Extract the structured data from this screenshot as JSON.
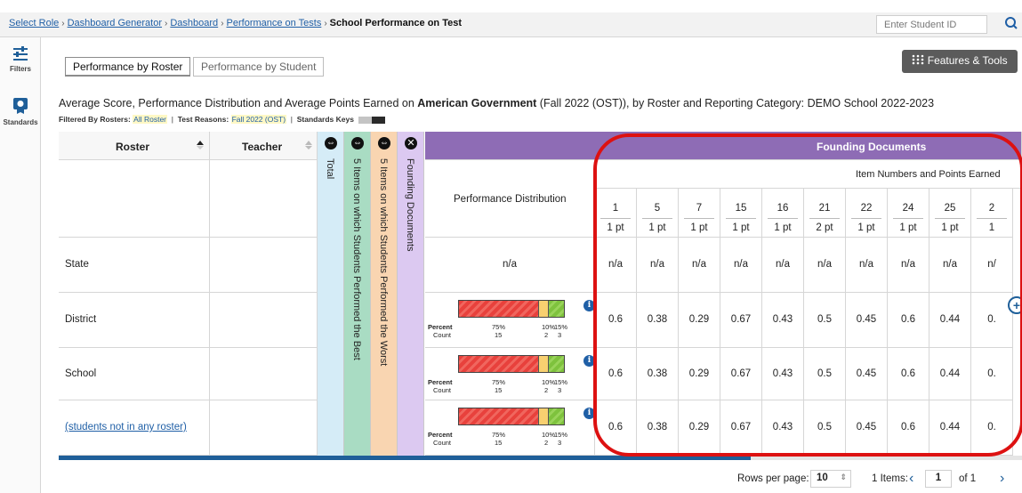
{
  "breadcrumb": {
    "items": [
      "Select Role",
      "Dashboard Generator",
      "Dashboard",
      "Performance on Tests"
    ],
    "current": "School Performance on Test",
    "separator": "›"
  },
  "search": {
    "placeholder": "Enter Student ID"
  },
  "rail": {
    "filters_label": "Filters",
    "standards_label": "Standards"
  },
  "tabs": {
    "by_roster": "Performance by Roster",
    "by_student": "Performance by Student"
  },
  "features_button": {
    "icon": "grid-dots-icon",
    "label": "Features & Tools"
  },
  "headline": {
    "prefix": "Average Score, Performance Distribution and Average Points Earned on ",
    "test_name": "American Government",
    "suffix": " (Fall 2022 (OST)), by Roster and Reporting Category: DEMO School 2022-2023"
  },
  "filters": {
    "filtered_by": "Filtered By",
    "rosters_label": "Rosters:",
    "rosters_value": "All Roster",
    "reasons_label": "Test Reasons:",
    "reasons_value": "Fall 2022 (OST)",
    "keys_label": "Standards Keys",
    "sep": "|"
  },
  "table": {
    "col_roster": "Roster",
    "col_teacher": "Teacher",
    "col_total": "Total",
    "col_best": "5 Items on which Students Performed the Best",
    "col_worst": "5 Items on which Students Performed the Worst",
    "col_founding": "Founding Documents",
    "group_header": "Founding Documents",
    "col_perf_dist": "Performance Distribution",
    "items_header": "Item Numbers and Points Earned",
    "items": [
      {
        "num": "1",
        "pts": "1 pt"
      },
      {
        "num": "5",
        "pts": "1 pt"
      },
      {
        "num": "7",
        "pts": "1 pt"
      },
      {
        "num": "15",
        "pts": "1 pt"
      },
      {
        "num": "16",
        "pts": "1 pt"
      },
      {
        "num": "21",
        "pts": "2 pt"
      },
      {
        "num": "22",
        "pts": "1 pt"
      },
      {
        "num": "24",
        "pts": "1 pt"
      },
      {
        "num": "25",
        "pts": "1 pt"
      },
      {
        "num": "2",
        "pts": "1"
      }
    ],
    "rows": [
      {
        "roster": "State",
        "perf": "n/a",
        "vals": [
          "n/a",
          "n/a",
          "n/a",
          "n/a",
          "n/a",
          "n/a",
          "n/a",
          "n/a",
          "n/a",
          "n/"
        ]
      },
      {
        "roster": "District",
        "vals": [
          "0.6",
          "0.38",
          "0.29",
          "0.67",
          "0.43",
          "0.5",
          "0.45",
          "0.6",
          "0.44",
          "0."
        ]
      },
      {
        "roster": "School",
        "vals": [
          "0.6",
          "0.38",
          "0.29",
          "0.67",
          "0.43",
          "0.5",
          "0.45",
          "0.6",
          "0.44",
          "0."
        ]
      },
      {
        "roster": "(students not in any roster)",
        "vals": [
          "0.6",
          "0.38",
          "0.29",
          "0.67",
          "0.43",
          "0.5",
          "0.45",
          "0.6",
          "0.44",
          "0."
        ]
      }
    ],
    "distribution": {
      "percent_label": "Percent",
      "count_label": "Count",
      "p1": "75%",
      "p2": "10%",
      "p3": "15%",
      "c1": "15",
      "c2": "2",
      "c3": "3",
      "segments_pct": [
        75,
        10,
        15
      ]
    }
  },
  "pager": {
    "rows_per_page_label": "Rows per page:",
    "rows_per_page": "10",
    "items_label": "1 Items:",
    "page": "1",
    "of_label": "of 1"
  },
  "colors": {
    "header_purple": "#8e6cb5",
    "col_total": "#d5ecf7",
    "col_best": "#a9dcc3",
    "col_worst": "#f9d5b1",
    "col_founding": "#dcc9f1",
    "highlight_ring": "#dd1111",
    "scrollbar": "#1f5f99"
  }
}
